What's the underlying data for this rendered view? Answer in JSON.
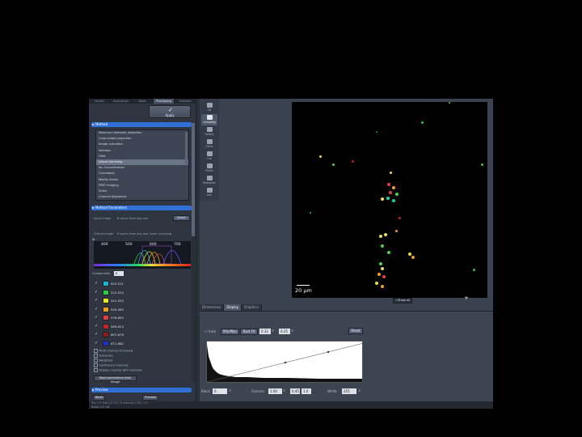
{
  "left_panel": {
    "tabs": [
      {
        "label": "Locate"
      },
      {
        "label": "Acquisition"
      },
      {
        "label": "Maps"
      },
      {
        "label": "Processing"
      },
      {
        "label": "Maintain"
      }
    ],
    "apply_label": "Apply",
    "method_header": "Method",
    "methods": [
      "Maximum intensity projection",
      "Color-coded projection",
      "Image calculator",
      "Average",
      "Filter",
      "Linear Unmixing",
      "Ion Concentration",
      "Correlation",
      "Modify Series",
      "FRET Imaging",
      "Stitch",
      "Channel Alignment"
    ],
    "selected_method": "Linear Unmixing",
    "params_header": "Method Parameters",
    "input_label": "Input Image",
    "input_value": "8 colors from day one",
    "select_label": "Select",
    "output_label": "Output Image",
    "output_value": "8 colors from day one_linear unmixing",
    "spectrum_axis": [
      "400",
      "500",
      "600",
      "700"
    ],
    "components_label": "Components",
    "components_value": "8",
    "channels": [
      {
        "name": "503-511",
        "color": "#19b5d6"
      },
      {
        "name": "515-524",
        "color": "#2ecc40"
      },
      {
        "name": "541-555",
        "color": "#e6e62a"
      },
      {
        "name": "545-565",
        "color": "#f0a020"
      },
      {
        "name": "578-605",
        "color": "#e04040"
      },
      {
        "name": "589-613",
        "color": "#c02828"
      },
      {
        "name": "607-676",
        "color": "#8a1c1c"
      },
      {
        "name": "671-682",
        "color": "#2030c0"
      }
    ],
    "options": [
      "Multi Channel Unmixing",
      "Autoscale",
      "Weighted",
      "Confidence Intervals",
      "Display channel with residuals"
    ],
    "read_params_label": "Read parameters from Image",
    "preview_header": "Preview",
    "reset_label": "Reset",
    "preview_label": "Preview"
  },
  "tools": [
    {
      "label": "2D",
      "icon": "2d-view-icon"
    },
    {
      "label": "Unmixing",
      "icon": "unmixing-icon"
    },
    {
      "label": "Gallery",
      "icon": "gallery-icon"
    },
    {
      "label": "Ortho",
      "icon": "ortho-icon"
    },
    {
      "label": "Cut",
      "icon": "cut-icon"
    },
    {
      "label": "Profile",
      "icon": "profile-icon"
    },
    {
      "label": "Histogram",
      "icon": "histogram-icon"
    },
    {
      "label": "Info",
      "icon": "info-icon"
    }
  ],
  "viewer": {
    "scale_label": "20 µm",
    "show_all_label": "Show all"
  },
  "bottom_tabs": [
    {
      "label": "Dimensions"
    },
    {
      "label": "Display"
    },
    {
      "label": "Graphics"
    }
  ],
  "display_panel": {
    "auto_label": "Auto",
    "minmax_label": "Min/Max",
    "bestfit_label": "Best Fit",
    "bestfit_low": "0.32",
    "bestfit_high": "0.25",
    "reset_label": "Reset",
    "black_label": "Black",
    "black_value": "0",
    "gamma_label": "Gamma",
    "gamma_value": "1.00",
    "gamma_a": "0.45",
    "gamma_b": "1.0",
    "white_label": "White",
    "white_value": "255"
  },
  "status_bar": {
    "line1": "Dim    1/1    Pixel (X)    0.5 / 8    Intensity 0 (R) / 1.5",
    "line2": "Ready    1/2  1/8"
  },
  "colors": {
    "accent": "#2f6fd6",
    "panel": "#3a4250",
    "image_bg": "#000000"
  }
}
